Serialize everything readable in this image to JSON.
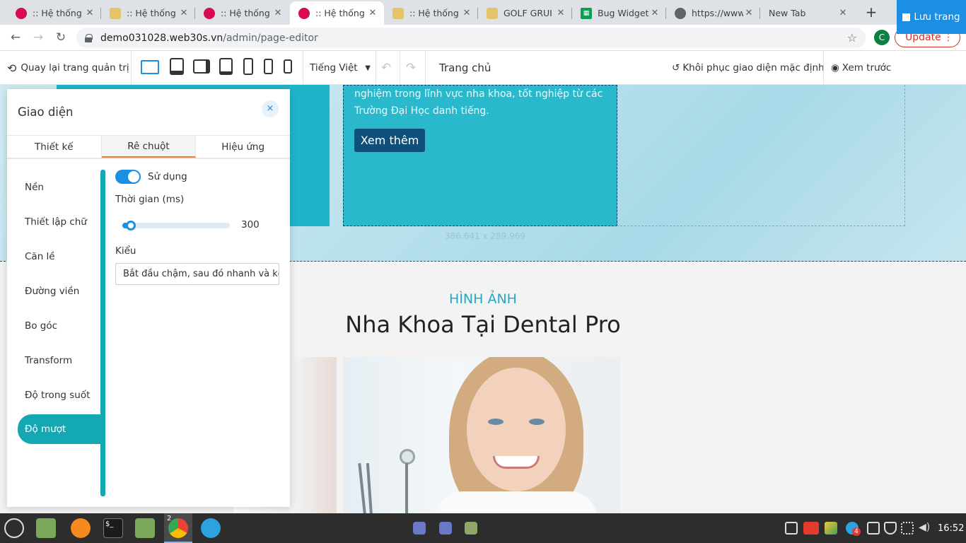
{
  "browser": {
    "tabs": [
      {
        "title": ":: Hệ thống",
        "favicon": "debian-swirl-icon",
        "color": "#d70a53"
      },
      {
        "title": ":: Hệ thống",
        "favicon": "page-icon",
        "color": "#e3c46b"
      },
      {
        "title": ":: Hệ thống",
        "favicon": "debian-swirl-icon",
        "color": "#d70a53"
      },
      {
        "title": ":: Hệ thống",
        "favicon": "debian-swirl-icon",
        "color": "#d70a53",
        "active": true
      },
      {
        "title": ":: Hệ thống",
        "favicon": "page-icon",
        "color": "#e3c46b"
      },
      {
        "title": "GOLF GRUI",
        "favicon": "page-icon",
        "color": "#e3c46b"
      },
      {
        "title": "Bug Widget",
        "favicon": "sheets-icon",
        "color": "#0f9d58"
      },
      {
        "title": "https://www",
        "favicon": "globe-icon",
        "color": "#5f6368"
      },
      {
        "title": "New Tab",
        "favicon": "",
        "color": ""
      }
    ],
    "url_host": "demo031028.web30s.vn",
    "url_path": "/admin/page-editor",
    "profile_initial": "C",
    "update_label": "Update"
  },
  "toolbar": {
    "back_label": "Quay lại trang quản trị",
    "language": "Tiếng Việt",
    "page_name": "Trang chủ",
    "restore_label": "Khôi phục giao diện mặc định",
    "preview_label": "Xem trước",
    "save_label": "Lưu trang",
    "accent": "#1a8fe3"
  },
  "canvas": {
    "hero_text_line1": "nghiệm trong lĩnh vực nha khoa, tốt nghiệp từ các",
    "hero_text_line2": "Trường Đại Học danh tiếng.",
    "hero_button": "Xem thêm",
    "dimension_label": "386.641 x 289.969",
    "section_kicker": "HÌNH ẢNH",
    "section_title": "Nha Khoa Tại Dental Pro"
  },
  "panel": {
    "title": "Giao diện",
    "close_icon": "×",
    "tabs": [
      "Thiết kế",
      "Rê chuột",
      "Hiệu ứng"
    ],
    "active_tab": 1,
    "side_items": [
      "Nền",
      "Thiết lập chữ",
      "Căn lề",
      "Đường viền",
      "Bo góc",
      "Transform",
      "Độ trong suốt",
      "Độ mượt"
    ],
    "active_side_item": 7,
    "use_toggle_label": "Sử dụng",
    "use_toggle_on": true,
    "duration_label": "Thời gian (ms)",
    "duration_value": "300",
    "duration_fraction": 0.08,
    "style_label": "Kiểu",
    "style_value": "Bắt đầu chậm, sau đó nhanh và kết thúc chậm",
    "accent": "#14a8b3"
  },
  "taskbar": {
    "time": "16:52",
    "chrome_badge": "2",
    "telegram_badge": "4"
  }
}
